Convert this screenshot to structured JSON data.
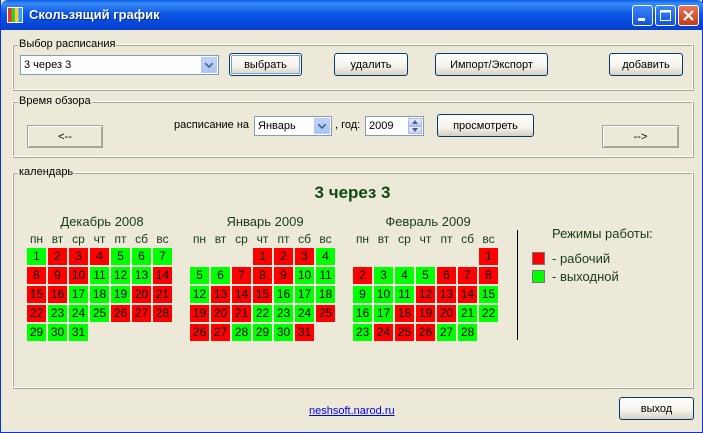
{
  "window": {
    "title": "Скользящий график"
  },
  "schedule_group": {
    "legend": "Выбор расписания",
    "selected": "3 через 3",
    "buttons": {
      "select": "выбрать",
      "delete": "удалить",
      "import_export": "Импорт/Экспорт",
      "add": "добавить"
    }
  },
  "view_group": {
    "legend": "Время обзора",
    "prev": "<--",
    "next": "-->",
    "schedule_on_label": "расписание на",
    "month_selected": "Январь",
    "year_label": ", год:",
    "year_value": "2009",
    "view_button": "просмотреть"
  },
  "calendar_group": {
    "legend": "календарь",
    "title": "3 через 3",
    "weekdays": [
      "пн",
      "вт",
      "ср",
      "чт",
      "пт",
      "сб",
      "вс"
    ],
    "months": [
      {
        "name": "Декабрь 2008",
        "cells": [
          {
            "d": "1",
            "t": "o"
          },
          {
            "d": "2",
            "t": "w"
          },
          {
            "d": "3",
            "t": "w"
          },
          {
            "d": "4",
            "t": "w"
          },
          {
            "d": "5",
            "t": "o"
          },
          {
            "d": "6",
            "t": "o"
          },
          {
            "d": "7",
            "t": "o"
          },
          {
            "d": "8",
            "t": "w"
          },
          {
            "d": "9",
            "t": "w"
          },
          {
            "d": "10",
            "t": "w"
          },
          {
            "d": "11",
            "t": "o"
          },
          {
            "d": "12",
            "t": "o"
          },
          {
            "d": "13",
            "t": "o"
          },
          {
            "d": "14",
            "t": "w"
          },
          {
            "d": "15",
            "t": "w"
          },
          {
            "d": "16",
            "t": "w"
          },
          {
            "d": "17",
            "t": "o"
          },
          {
            "d": "18",
            "t": "o"
          },
          {
            "d": "19",
            "t": "o"
          },
          {
            "d": "20",
            "t": "w"
          },
          {
            "d": "21",
            "t": "w"
          },
          {
            "d": "22",
            "t": "w"
          },
          {
            "d": "23",
            "t": "o"
          },
          {
            "d": "24",
            "t": "o"
          },
          {
            "d": "25",
            "t": "o"
          },
          {
            "d": "26",
            "t": "w"
          },
          {
            "d": "27",
            "t": "w"
          },
          {
            "d": "28",
            "t": "w"
          },
          {
            "d": "29",
            "t": "o"
          },
          {
            "d": "30",
            "t": "o"
          },
          {
            "d": "31",
            "t": "o"
          }
        ]
      },
      {
        "name": "Январь 2009",
        "cells": [
          {
            "d": "",
            "t": "e"
          },
          {
            "d": "",
            "t": "e"
          },
          {
            "d": "",
            "t": "e"
          },
          {
            "d": "1",
            "t": "w"
          },
          {
            "d": "2",
            "t": "w"
          },
          {
            "d": "3",
            "t": "w"
          },
          {
            "d": "4",
            "t": "o"
          },
          {
            "d": "5",
            "t": "o"
          },
          {
            "d": "6",
            "t": "o"
          },
          {
            "d": "7",
            "t": "w"
          },
          {
            "d": "8",
            "t": "w"
          },
          {
            "d": "9",
            "t": "w"
          },
          {
            "d": "10",
            "t": "o"
          },
          {
            "d": "11",
            "t": "o"
          },
          {
            "d": "12",
            "t": "o"
          },
          {
            "d": "13",
            "t": "w"
          },
          {
            "d": "14",
            "t": "w"
          },
          {
            "d": "15",
            "t": "w"
          },
          {
            "d": "16",
            "t": "o"
          },
          {
            "d": "17",
            "t": "o"
          },
          {
            "d": "18",
            "t": "o"
          },
          {
            "d": "19",
            "t": "w"
          },
          {
            "d": "20",
            "t": "w"
          },
          {
            "d": "21",
            "t": "w"
          },
          {
            "d": "22",
            "t": "o"
          },
          {
            "d": "23",
            "t": "o"
          },
          {
            "d": "24",
            "t": "o"
          },
          {
            "d": "25",
            "t": "w"
          },
          {
            "d": "26",
            "t": "w"
          },
          {
            "d": "27",
            "t": "w"
          },
          {
            "d": "28",
            "t": "o"
          },
          {
            "d": "29",
            "t": "o"
          },
          {
            "d": "30",
            "t": "o"
          },
          {
            "d": "31",
            "t": "w"
          }
        ]
      },
      {
        "name": "Февраль 2009",
        "cells": [
          {
            "d": "",
            "t": "e"
          },
          {
            "d": "",
            "t": "e"
          },
          {
            "d": "",
            "t": "e"
          },
          {
            "d": "",
            "t": "e"
          },
          {
            "d": "",
            "t": "e"
          },
          {
            "d": "",
            "t": "e"
          },
          {
            "d": "1",
            "t": "w"
          },
          {
            "d": "2",
            "t": "w"
          },
          {
            "d": "3",
            "t": "o"
          },
          {
            "d": "4",
            "t": "o"
          },
          {
            "d": "5",
            "t": "o"
          },
          {
            "d": "6",
            "t": "w"
          },
          {
            "d": "7",
            "t": "w"
          },
          {
            "d": "8",
            "t": "w"
          },
          {
            "d": "9",
            "t": "o"
          },
          {
            "d": "10",
            "t": "o"
          },
          {
            "d": "11",
            "t": "o"
          },
          {
            "d": "12",
            "t": "w"
          },
          {
            "d": "13",
            "t": "w"
          },
          {
            "d": "14",
            "t": "w"
          },
          {
            "d": "15",
            "t": "o"
          },
          {
            "d": "16",
            "t": "o"
          },
          {
            "d": "17",
            "t": "o"
          },
          {
            "d": "18",
            "t": "w"
          },
          {
            "d": "19",
            "t": "w"
          },
          {
            "d": "20",
            "t": "w"
          },
          {
            "d": "21",
            "t": "o"
          },
          {
            "d": "22",
            "t": "o"
          },
          {
            "d": "23",
            "t": "o"
          },
          {
            "d": "24",
            "t": "w"
          },
          {
            "d": "25",
            "t": "w"
          },
          {
            "d": "26",
            "t": "w"
          },
          {
            "d": "27",
            "t": "o"
          },
          {
            "d": "28",
            "t": "o"
          }
        ]
      }
    ],
    "legend_title": "Режимы работы:",
    "legend_items": [
      {
        "label": "- рабочий",
        "color": "#FF0000"
      },
      {
        "label": "- выходной",
        "color": "#00FF00"
      }
    ]
  },
  "footer": {
    "link": "neshsoft.narod.ru",
    "exit": "выход"
  }
}
